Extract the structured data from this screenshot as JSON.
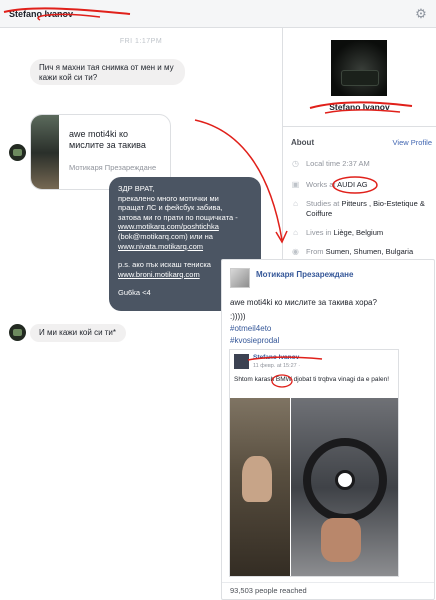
{
  "header": {
    "title": "Stefano Ivanov",
    "settings_icon": "gear-icon"
  },
  "chat": {
    "timestamp": "FRI 1:17PM",
    "messages": [
      {
        "direction": "in",
        "text": "Пич я махни тая снимка от мен и му кажи кой си ти?"
      },
      {
        "direction": "in",
        "type": "share",
        "title": "awe moti4ki ко мислите за такива",
        "source": "Мотикаря Презареждане"
      },
      {
        "direction": "out",
        "lines": [
          "ЗДР ВРАТ,",
          "прекалено много мотички ми",
          "пращат ЛС и фейсбук забива,",
          "затова ми го прати по пощичката -",
          "www.motikarq.com/poshtichka",
          "(bok@motikarq.com)  или на",
          "www.nivata.motikarq.com",
          "",
          "р.s. ако пък искаш тениска",
          "www.broni.motikarq.com",
          "",
          "Gu6ka <4"
        ]
      },
      {
        "direction": "in",
        "text": "И ми кажи кой си ти*"
      }
    ]
  },
  "profile": {
    "name": "Stefano Ivanov",
    "about_label": "About",
    "view_profile": "View Profile",
    "info": [
      {
        "icon": "clock-icon",
        "prefix": "Local time ",
        "value": "2:37 AM"
      },
      {
        "icon": "briefcase-icon",
        "prefix": "Works at ",
        "value": "AUDI AG"
      },
      {
        "icon": "graduation-icon",
        "prefix": "Studies at ",
        "value": "Pitteurs , Bio-Estetique & Coiffure"
      },
      {
        "icon": "home-icon",
        "prefix": "Lives in ",
        "value": "Liège, Belgium"
      },
      {
        "icon": "pin-icon",
        "prefix": "From ",
        "value": "Sumen, Shumen, Bulgaria"
      }
    ]
  },
  "post": {
    "author": "Мотикаря Презареждане",
    "text": "awe moti4ki ко мислите за такива хора?",
    "smiley": ":)))))",
    "tags": [
      "#otmeil4eto",
      "#kvosieprodal"
    ],
    "shared": {
      "name": "Stefano Ivanov",
      "date": "11 февр. at 15:27 · ",
      "text": "Shtom karash BMW djobat ti trqbva vinagi da e palen!"
    },
    "reached": "93,503 people reached"
  }
}
